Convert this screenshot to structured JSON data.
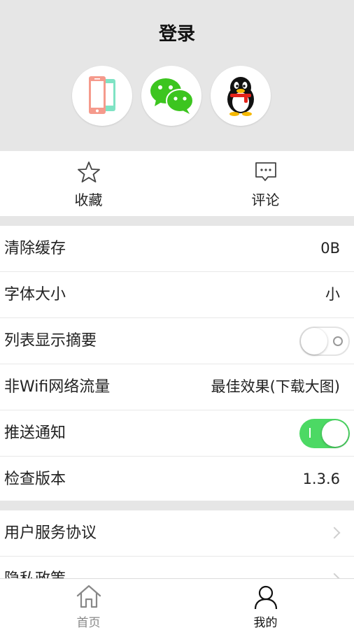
{
  "header": {
    "title": "登录",
    "login_methods": [
      "phone-login",
      "wechat-login",
      "qq-login"
    ]
  },
  "quick_actions": [
    {
      "label": "收藏",
      "icon": "star-icon"
    },
    {
      "label": "评论",
      "icon": "comment-icon"
    }
  ],
  "settings": {
    "clear_cache": {
      "label": "清除缓存",
      "value": "0B"
    },
    "font_size": {
      "label": "字体大小",
      "value": "小"
    },
    "list_summary": {
      "label": "列表显示摘要",
      "enabled": false
    },
    "non_wifi": {
      "label": "非Wifi网络流量",
      "value": "最佳效果(下载大图)"
    },
    "push": {
      "label": "推送通知",
      "enabled": true
    },
    "version": {
      "label": "检查版本",
      "value": "1.3.6"
    }
  },
  "links": [
    {
      "label": "用户服务协议"
    },
    {
      "label": "隐私政策"
    }
  ],
  "tabbar": [
    {
      "label": "首页",
      "icon": "home-icon",
      "active": false
    },
    {
      "label": "我的",
      "icon": "user-icon",
      "active": true
    }
  ],
  "colors": {
    "header_bg": "#e6e6e6",
    "toggle_on": "#4cd964",
    "wechat_green": "#3cc51f"
  }
}
